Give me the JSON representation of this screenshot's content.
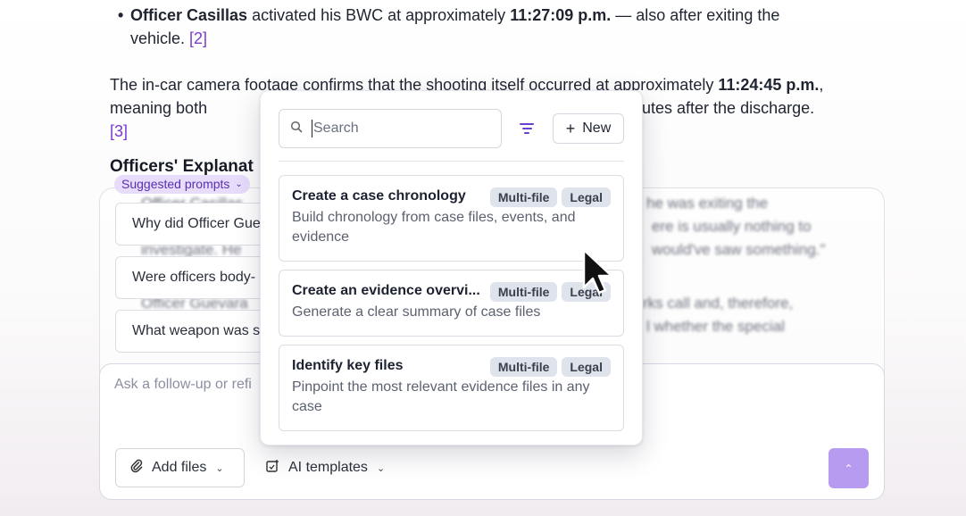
{
  "document": {
    "bullet_officer": "Officer Casillas",
    "bullet_mid": " activated his BWC at approximately ",
    "bullet_time": "11:27:09 p.m.",
    "bullet_end": " — also after exiting the vehicle.",
    "bullet_cite": "[2]",
    "para_start": "The in-car camera footage confirms that the shooting itself occurred at approximately ",
    "para_time": "11:24:45 p.m.",
    "para_mid": ", meaning both",
    "para_end": "utes after the discharge.",
    "para_cite": "[3]",
    "section_heading": "Officers' Explanat"
  },
  "background_blur": {
    "line1": "Officer Casillas",
    "line2": "investigate. He",
    "line3": "Officer Guevara",
    "right1": "he was exiting the",
    "right2": "ere is usually nothing to",
    "right3": "would've saw something.\"",
    "right4": "rks call and, therefore,",
    "right5": "l whether the special"
  },
  "suggested_prompts": {
    "label": "Suggested prompts",
    "items": [
      "Why did Officer Gue",
      "Were officers body-",
      "What weapon was s"
    ]
  },
  "composer": {
    "placeholder": "Ask a follow-up or refi",
    "add_files_label": "Add files",
    "ai_templates_label": "AI templates"
  },
  "dropdown": {
    "search_placeholder": "Search",
    "new_label": "New",
    "templates": [
      {
        "title": "Create a case chronology",
        "description": "Build chronology from case files, events, and evidence",
        "tags": [
          "Multi-file",
          "Legal"
        ]
      },
      {
        "title": "Create an evidence overvi...",
        "description": "Generate a clear summary of case files",
        "tags": [
          "Multi-file",
          "Legal"
        ]
      },
      {
        "title": "Identify key files",
        "description": "Pinpoint the most relevant evidence files in any case",
        "tags": [
          "Multi-file",
          "Legal"
        ]
      }
    ]
  },
  "colors": {
    "accent": "#7a3ad0",
    "send_button": "#b69bf0",
    "pill_bg": "#e8dcfb",
    "tag_bg": "#dfe3ec"
  }
}
